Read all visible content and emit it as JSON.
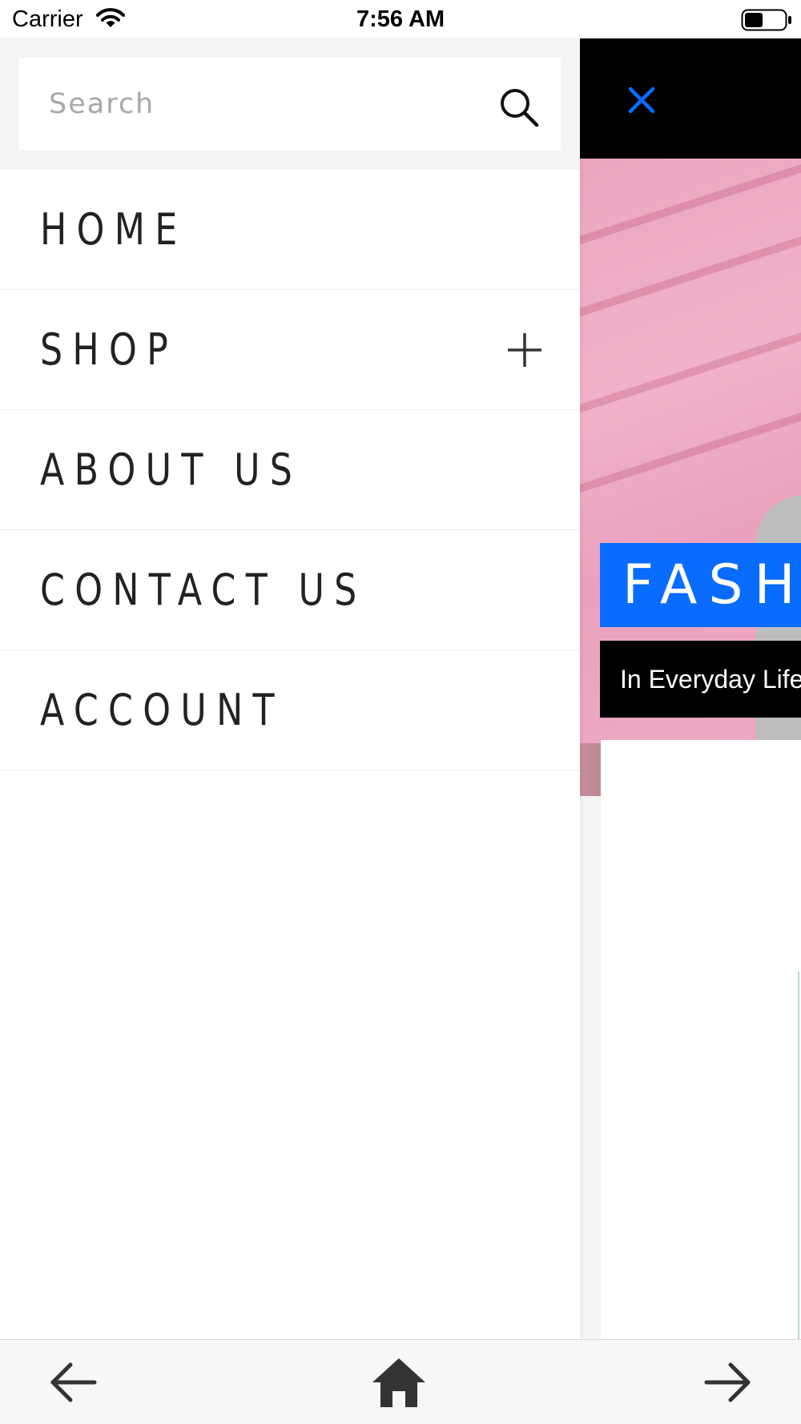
{
  "status_bar": {
    "carrier": "Carrier",
    "time": "7:56 AM",
    "icons": [
      "wifi-icon",
      "battery-icon"
    ]
  },
  "drawer": {
    "search": {
      "placeholder": "Search",
      "value": "",
      "icon": "search-icon"
    },
    "menu_items": [
      {
        "label": "HOME"
      },
      {
        "label": "SHOP",
        "icon": "plus-icon"
      },
      {
        "label": "ABOUT US"
      },
      {
        "label": "CONTACT US"
      },
      {
        "label": "ACCOUNT"
      }
    ]
  },
  "main": {
    "close_icon": "close-icon",
    "banner_title": "FASHION",
    "banner_subtitle": "In Everyday Life"
  },
  "bottom_bar": {
    "icons": [
      "arrow-left-icon",
      "home-icon",
      "arrow-right-icon"
    ]
  },
  "colors": {
    "accent_blue": "#0a6cff",
    "header_black": "#000000",
    "menu_text": "#222222",
    "search_bg": "#f5f5f5",
    "hero_pink": "#eba6c0"
  }
}
